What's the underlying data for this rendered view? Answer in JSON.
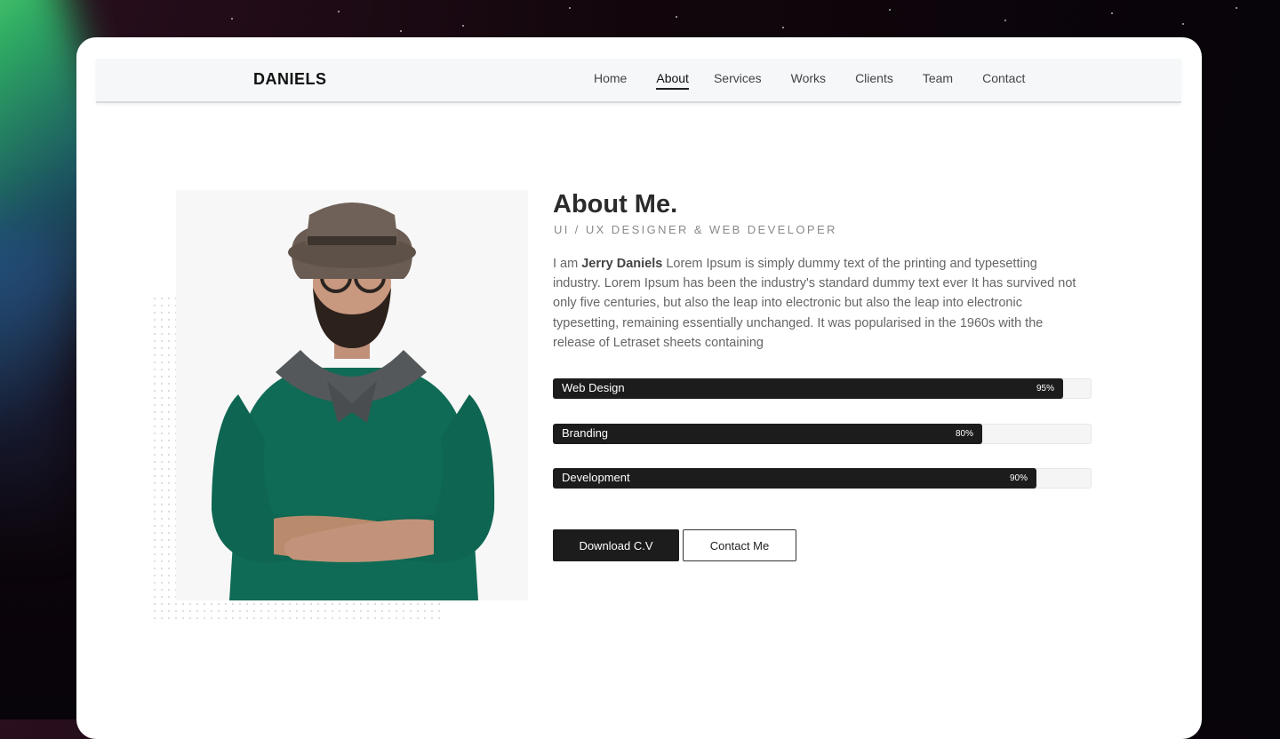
{
  "brand": "DANIELS",
  "nav": [
    {
      "label": "Home",
      "active": false
    },
    {
      "label": "About",
      "active": true
    },
    {
      "label": "Services",
      "active": false
    },
    {
      "label": "Works",
      "active": false
    },
    {
      "label": "Clients",
      "active": false
    },
    {
      "label": "Team",
      "active": false
    },
    {
      "label": "Contact",
      "active": false
    }
  ],
  "about": {
    "title": "About Me.",
    "subtitle": "UI / UX DESIGNER & WEB DEVELOPER",
    "bio_prefix": "I am ",
    "bio_name": "Jerry Daniels",
    "bio_text": " Lorem Ipsum is simply dummy text of the printing and typesetting industry. Lorem Ipsum has been the industry's standard dummy text ever It has survived not only five centuries, but also the leap into electronic but also the leap into electronic typesetting, remaining essentially unchanged. It was popularised in the 1960s with the release of Letraset sheets containing"
  },
  "skills": [
    {
      "name": "Web Design",
      "percent": 95,
      "label": "95%"
    },
    {
      "name": "Branding",
      "percent": 80,
      "label": "80%"
    },
    {
      "name": "Development",
      "percent": 90,
      "label": "90%"
    }
  ],
  "buttons": {
    "download": "Download C.V",
    "contact": "Contact Me"
  },
  "colors": {
    "bar_fill": "#1c1c1c",
    "sweater": "#0f6b55",
    "accent_glow": "#4cd97b"
  }
}
